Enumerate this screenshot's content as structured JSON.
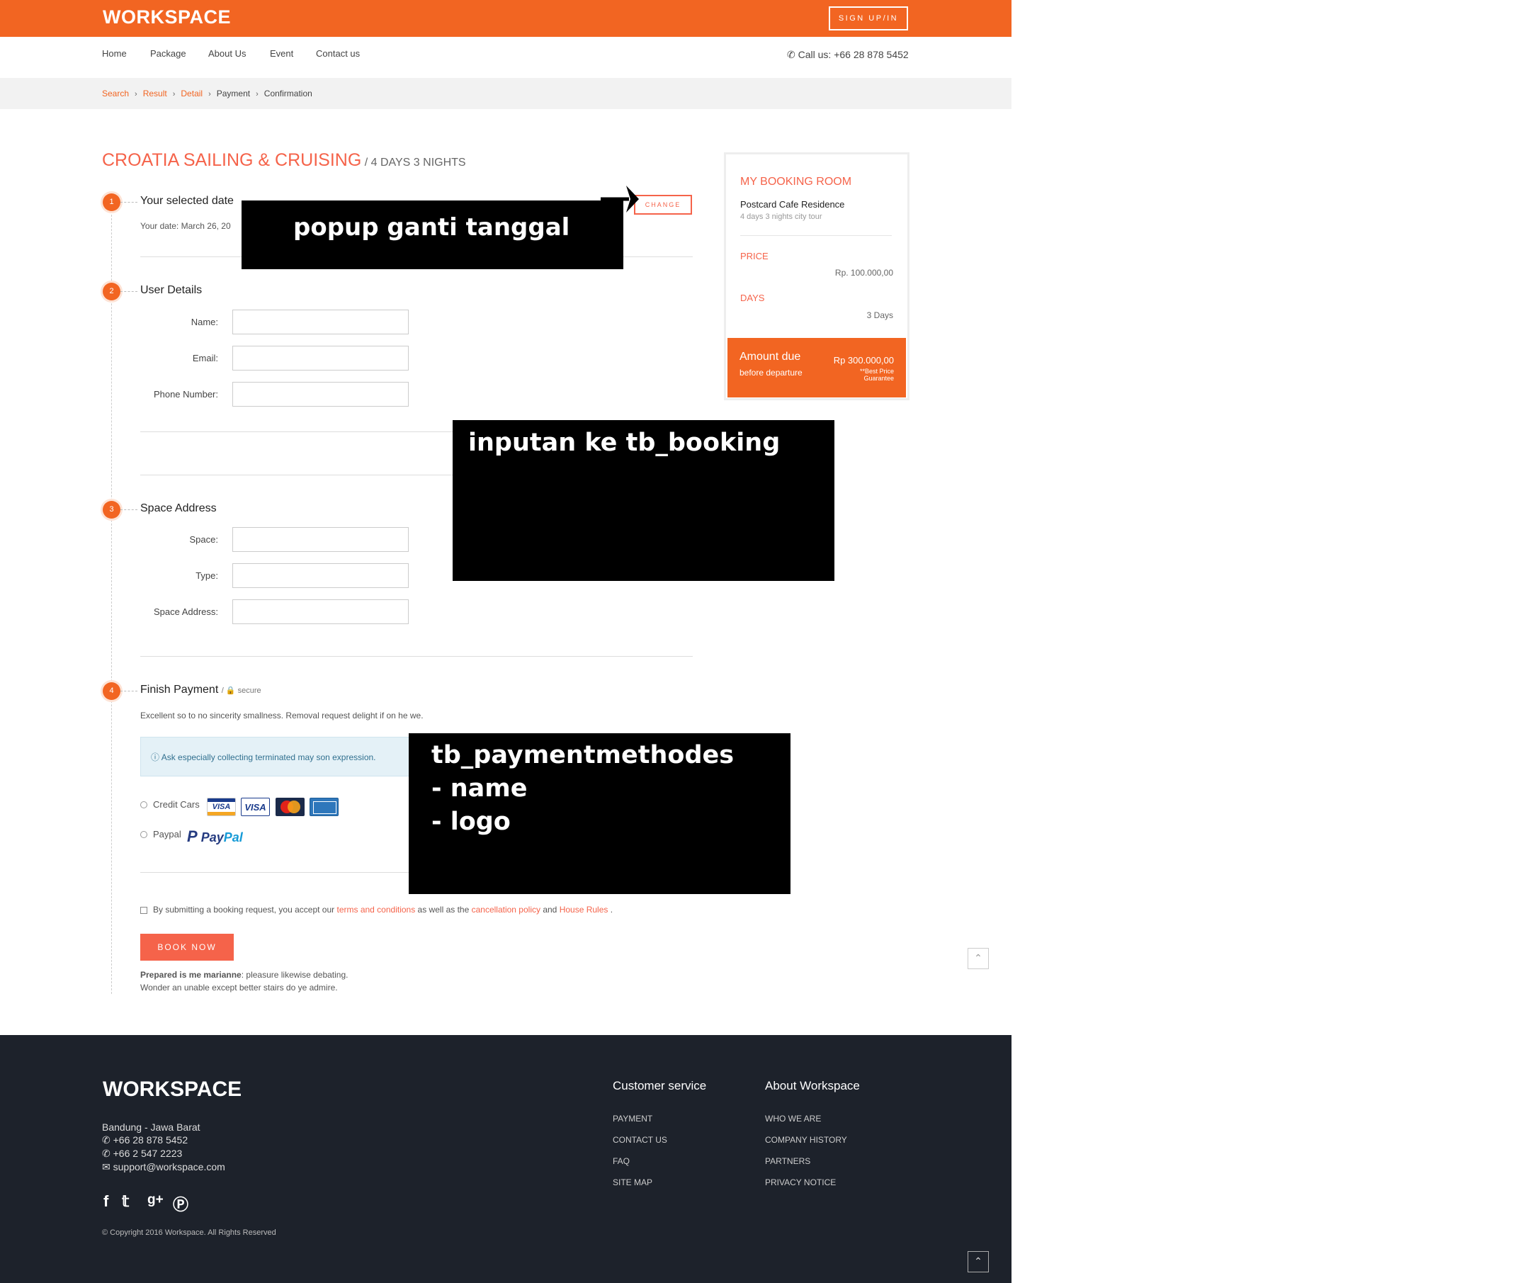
{
  "header": {
    "logo": "WORKSPACE",
    "signup_label": "SIGN UP/IN",
    "nav": [
      "Home",
      "Package",
      "About Us",
      "Event",
      "Contact us"
    ],
    "call": "Call us: +66 28 878 5452"
  },
  "breadcrumb": [
    "Search",
    "Result",
    "Detail",
    "Payment",
    "Confirmation"
  ],
  "title": {
    "main": "CROATIA SAILING & CRUISING",
    "sub": " / 4 DAYS 3 NIGHTS"
  },
  "steps": {
    "s1": {
      "num": "1",
      "title": "Your selected date",
      "text": "Your date: March 26, 20",
      "change_label": "CHANGE"
    },
    "s2": {
      "num": "2",
      "title": "User Details",
      "labels": [
        "Name:",
        "Email:",
        "Phone Number:"
      ]
    },
    "s3": {
      "num": "3",
      "title": "Space Address",
      "labels": [
        "Space:",
        "Type:",
        "Space Address:"
      ]
    },
    "s4": {
      "num": "4",
      "title": "Finish Payment",
      "secure": "/ 🔒 secure",
      "text": "Excellent so to no sincerity smallness. Removal request delight if on he we.",
      "info": "Ask especially collecting terminated may son expression.",
      "methods": [
        "Credit Cars",
        "Paypal"
      ],
      "cards": [
        "VISA",
        "VISA",
        "MasterCard",
        "AMERICAN EXPRESS"
      ],
      "paypal_a": "Pay",
      "paypal_b": "Pal"
    }
  },
  "terms": {
    "t1": "By submitting a booking request, you accept our ",
    "l1": "terms and conditions",
    "t2": " as well as the ",
    "l2": "cancellation policy",
    "t3": " and ",
    "l3": "House Rules",
    "t4": " ."
  },
  "book_label": "BOOK NOW",
  "prepared": {
    "bold": "Prepared is me marianne",
    "rest": ": pleasure likewise debating.",
    "line2": "Wonder an unable except better stairs do ye admire."
  },
  "booking": {
    "title": "MY BOOKING ROOM",
    "name": "Postcard Cafe Residence",
    "sub": "4 days 3 nights city tour",
    "price_label": "PRICE",
    "price": "Rp. 100.000,00",
    "days_label": "DAYS",
    "days": "3 Days",
    "due_title": "Amount due",
    "due_sub": "before departure",
    "due_amount": "Rp 300.000,00",
    "due_note": "**Best Price Guarantee"
  },
  "footer": {
    "logo": "WORKSPACE",
    "address": "Bandung - Jawa Barat",
    "phone1": "+66 28 878 5452",
    "phone2": "+66 2 547 2223",
    "email": "support@workspace.com",
    "copyright": "© Copyright 2016 Workspace. All Rights Reserved",
    "col1_title": "Customer service",
    "col1": [
      "PAYMENT",
      "CONTACT US",
      "FAQ",
      "SITE MAP"
    ],
    "col2_title": "About Workspace",
    "col2": [
      "WHO WE ARE",
      "COMPANY HISTORY",
      "PARTNERS",
      "PRIVACY NOTICE"
    ]
  },
  "annotations": {
    "a1": "popup ganti tanggal",
    "a2": "inputan ke tb_booking",
    "a3": [
      "tb_paymentmethodes",
      "- name",
      "- logo"
    ]
  },
  "icons": [
    "phone-icon",
    "lock-icon",
    "info-icon",
    "envelope-icon",
    "facebook-icon",
    "twitter-icon",
    "google-plus-icon",
    "pinterest-icon",
    "chevron-up-icon"
  ],
  "colors": {
    "brand": "#f26522",
    "accent": "#f5634a",
    "footer": "#1d222b"
  }
}
